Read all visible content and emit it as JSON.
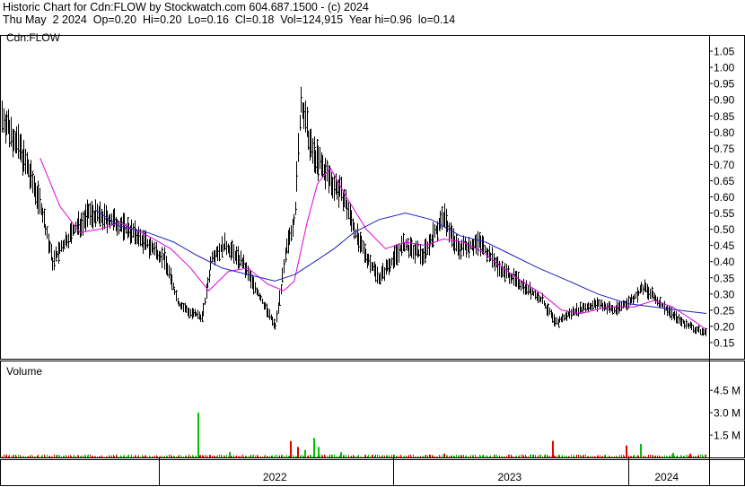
{
  "header": {
    "line1": "Historic Chart for Cdn:FLOW by Stockwatch.com 604.687.1500 - (c) 2024",
    "line2": "Thu May  2 2024  Op=0.20  Hi=0.20  Lo=0.16  Cl=0.18  Vol=124,915  Year hi=0.96  lo=0.14"
  },
  "chart_data": [
    {
      "type": "line",
      "title": "Cdn:FLOW",
      "ylim": [
        0.1,
        1.1
      ],
      "yticks": [
        1.05,
        1.0,
        0.95,
        0.9,
        0.85,
        0.8,
        0.75,
        0.7,
        0.65,
        0.6,
        0.55,
        0.5,
        0.45,
        0.4,
        0.35,
        0.3,
        0.25,
        0.2,
        0.15
      ],
      "ytick_labels": [
        "1.05",
        "1.00",
        "0.95",
        "0.90",
        "0.85",
        "0.80",
        "0.75",
        "0.70",
        "0.65",
        "0.60",
        "0.55",
        "0.50",
        "0.45",
        "0.40",
        "0.35",
        "0.30",
        "0.25",
        "0.20",
        "0.15"
      ],
      "xticks": [
        "2022",
        "2023",
        "2024"
      ],
      "x_range": [
        "2021-05",
        "2024-05"
      ],
      "grid": false,
      "series": [
        {
          "style": "price-bars",
          "color": "#000000",
          "points": [
            {
              "d": "2021-05-03",
              "v": 0.85
            },
            {
              "d": "2021-06-01",
              "v": 0.74
            },
            {
              "d": "2021-07-01",
              "v": 0.58
            },
            {
              "d": "2021-07-20",
              "v": 0.4
            },
            {
              "d": "2021-08-15",
              "v": 0.48
            },
            {
              "d": "2021-09-15",
              "v": 0.55
            },
            {
              "d": "2021-10-15",
              "v": 0.53
            },
            {
              "d": "2021-11-15",
              "v": 0.5
            },
            {
              "d": "2021-12-10",
              "v": 0.46
            },
            {
              "d": "2022-01-10",
              "v": 0.41
            },
            {
              "d": "2022-02-01",
              "v": 0.27
            },
            {
              "d": "2022-02-20",
              "v": 0.24
            },
            {
              "d": "2022-03-10",
              "v": 0.23
            },
            {
              "d": "2022-03-25",
              "v": 0.42
            },
            {
              "d": "2022-04-15",
              "v": 0.45
            },
            {
              "d": "2022-05-10",
              "v": 0.4
            },
            {
              "d": "2022-06-05",
              "v": 0.3
            },
            {
              "d": "2022-07-01",
              "v": 0.2
            },
            {
              "d": "2022-07-20",
              "v": 0.45
            },
            {
              "d": "2022-08-01",
              "v": 0.55
            },
            {
              "d": "2022-08-10",
              "v": 0.9
            },
            {
              "d": "2022-08-25",
              "v": 0.75
            },
            {
              "d": "2022-09-15",
              "v": 0.68
            },
            {
              "d": "2022-10-15",
              "v": 0.6
            },
            {
              "d": "2022-11-10",
              "v": 0.45
            },
            {
              "d": "2022-12-10",
              "v": 0.35
            },
            {
              "d": "2023-01-15",
              "v": 0.45
            },
            {
              "d": "2023-02-15",
              "v": 0.42
            },
            {
              "d": "2023-03-20",
              "v": 0.54
            },
            {
              "d": "2023-04-10",
              "v": 0.44
            },
            {
              "d": "2023-05-15",
              "v": 0.46
            },
            {
              "d": "2023-06-15",
              "v": 0.38
            },
            {
              "d": "2023-07-20",
              "v": 0.33
            },
            {
              "d": "2023-08-20",
              "v": 0.28
            },
            {
              "d": "2023-09-10",
              "v": 0.21
            },
            {
              "d": "2023-10-10",
              "v": 0.25
            },
            {
              "d": "2023-11-15",
              "v": 0.27
            },
            {
              "d": "2023-12-10",
              "v": 0.25
            },
            {
              "d": "2024-01-05",
              "v": 0.28
            },
            {
              "d": "2024-01-25",
              "v": 0.32
            },
            {
              "d": "2024-02-20",
              "v": 0.27
            },
            {
              "d": "2024-03-20",
              "v": 0.22
            },
            {
              "d": "2024-04-15",
              "v": 0.19
            },
            {
              "d": "2024-05-02",
              "v": 0.18
            }
          ]
        },
        {
          "style": "moving-average-short",
          "color": "#e000e0",
          "points": [
            {
              "d": "2021-07-01",
              "v": 0.72
            },
            {
              "d": "2021-08-01",
              "v": 0.57
            },
            {
              "d": "2021-09-01",
              "v": 0.49
            },
            {
              "d": "2021-10-01",
              "v": 0.5
            },
            {
              "d": "2021-11-01",
              "v": 0.52
            },
            {
              "d": "2021-12-15",
              "v": 0.48
            },
            {
              "d": "2022-01-20",
              "v": 0.44
            },
            {
              "d": "2022-02-20",
              "v": 0.38
            },
            {
              "d": "2022-03-20",
              "v": 0.31
            },
            {
              "d": "2022-04-20",
              "v": 0.37
            },
            {
              "d": "2022-05-20",
              "v": 0.38
            },
            {
              "d": "2022-06-20",
              "v": 0.33
            },
            {
              "d": "2022-07-15",
              "v": 0.31
            },
            {
              "d": "2022-07-31",
              "v": 0.34
            },
            {
              "d": "2022-08-20",
              "v": 0.52
            },
            {
              "d": "2022-09-05",
              "v": 0.64
            },
            {
              "d": "2022-09-25",
              "v": 0.69
            },
            {
              "d": "2022-10-20",
              "v": 0.6
            },
            {
              "d": "2022-11-20",
              "v": 0.5
            },
            {
              "d": "2022-12-20",
              "v": 0.44
            },
            {
              "d": "2023-01-20",
              "v": 0.46
            },
            {
              "d": "2023-02-20",
              "v": 0.45
            },
            {
              "d": "2023-03-20",
              "v": 0.47
            },
            {
              "d": "2023-04-20",
              "v": 0.46
            },
            {
              "d": "2023-05-20",
              "v": 0.43
            },
            {
              "d": "2023-06-20",
              "v": 0.38
            },
            {
              "d": "2023-07-20",
              "v": 0.34
            },
            {
              "d": "2023-08-20",
              "v": 0.3
            },
            {
              "d": "2023-09-20",
              "v": 0.25
            },
            {
              "d": "2023-10-20",
              "v": 0.24
            },
            {
              "d": "2023-12-01",
              "v": 0.26
            },
            {
              "d": "2024-01-10",
              "v": 0.26
            },
            {
              "d": "2024-02-10",
              "v": 0.28
            },
            {
              "d": "2024-03-10",
              "v": 0.26
            },
            {
              "d": "2024-04-10",
              "v": 0.22
            },
            {
              "d": "2024-05-02",
              "v": 0.19
            }
          ]
        },
        {
          "style": "moving-average-long",
          "color": "#2020c0",
          "points": [
            {
              "d": "2021-09-25",
              "v": 0.56
            },
            {
              "d": "2021-11-01",
              "v": 0.51
            },
            {
              "d": "2021-12-15",
              "v": 0.49
            },
            {
              "d": "2022-01-25",
              "v": 0.46
            },
            {
              "d": "2022-03-01",
              "v": 0.42
            },
            {
              "d": "2022-04-10",
              "v": 0.38
            },
            {
              "d": "2022-05-20",
              "v": 0.36
            },
            {
              "d": "2022-07-01",
              "v": 0.34
            },
            {
              "d": "2022-08-01",
              "v": 0.36
            },
            {
              "d": "2022-09-01",
              "v": 0.4
            },
            {
              "d": "2022-10-01",
              "v": 0.44
            },
            {
              "d": "2022-11-01",
              "v": 0.49
            },
            {
              "d": "2022-12-10",
              "v": 0.53
            },
            {
              "d": "2023-01-20",
              "v": 0.55
            },
            {
              "d": "2023-03-01",
              "v": 0.53
            },
            {
              "d": "2023-04-15",
              "v": 0.48
            },
            {
              "d": "2023-05-25",
              "v": 0.46
            },
            {
              "d": "2023-07-05",
              "v": 0.42
            },
            {
              "d": "2023-08-15",
              "v": 0.38
            },
            {
              "d": "2023-10-01",
              "v": 0.34
            },
            {
              "d": "2023-11-15",
              "v": 0.3
            },
            {
              "d": "2024-01-01",
              "v": 0.27
            },
            {
              "d": "2024-02-10",
              "v": 0.26
            },
            {
              "d": "2024-03-20",
              "v": 0.25
            },
            {
              "d": "2024-05-02",
              "v": 0.24
            }
          ]
        }
      ]
    },
    {
      "type": "bar",
      "title": "Volume",
      "ylim": [
        0,
        6500000
      ],
      "yticks": [
        4500000,
        3000000,
        1500000
      ],
      "ytick_labels": [
        "4.5 M",
        "3.0 M",
        "1.5 M"
      ],
      "colors": {
        "up": "#00c000",
        "down": "#e00000"
      },
      "series": [
        {
          "name": "",
          "points": [
            {
              "d": "2022-03-03",
              "v": 3000000,
              "dir": "up"
            },
            {
              "d": "2022-04-20",
              "v": 350000,
              "dir": "up"
            },
            {
              "d": "2022-07-25",
              "v": 1100000,
              "dir": "down"
            },
            {
              "d": "2022-08-05",
              "v": 700000,
              "dir": "down"
            },
            {
              "d": "2022-08-15",
              "v": 500000,
              "dir": "up"
            },
            {
              "d": "2022-08-30",
              "v": 1300000,
              "dir": "up"
            },
            {
              "d": "2022-09-05",
              "v": 700000,
              "dir": "up"
            },
            {
              "d": "2022-10-10",
              "v": 350000,
              "dir": "up"
            },
            {
              "d": "2023-03-20",
              "v": 250000,
              "dir": "down"
            },
            {
              "d": "2023-09-05",
              "v": 1100000,
              "dir": "down"
            },
            {
              "d": "2023-12-28",
              "v": 800000,
              "dir": "down"
            },
            {
              "d": "2024-01-20",
              "v": 900000,
              "dir": "up"
            },
            {
              "d": "2024-03-10",
              "v": 300000,
              "dir": "up"
            },
            {
              "d": "2024-04-05",
              "v": 250000,
              "dir": "down"
            }
          ]
        }
      ]
    }
  ]
}
